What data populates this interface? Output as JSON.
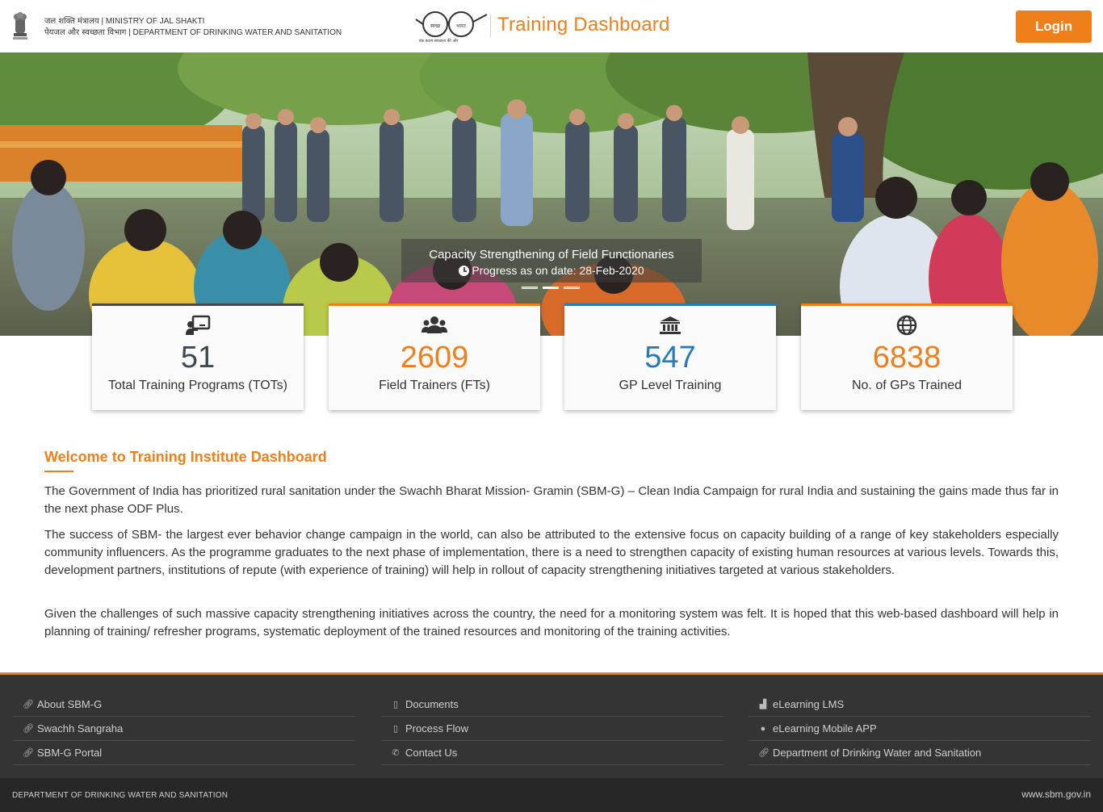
{
  "header": {
    "ministry_line1_hi": "जल शक्ति मंत्रालय",
    "ministry_line1_en": "MINISTRY OF JAL SHAKTI",
    "ministry_line2_hi": "पेयजल और स्वच्छता विभाग",
    "ministry_line2_en": "DEPARTMENT OF DRINKING WATER AND SANITATION",
    "logo_text_left": "स्वच्छ",
    "logo_text_right": "भारत",
    "logo_tagline": "एक कदम स्वच्छता की ओर",
    "title": "Training Dashboard",
    "login_label": "Login"
  },
  "hero": {
    "caption_title": "Capacity Strengthening of Field Functionaries",
    "caption_sub": "Progress as on date: 28-Feb-2020",
    "slide_count": 3,
    "active_slide": 2
  },
  "stats": [
    {
      "icon": "chalkboard-teacher-icon",
      "value": "51",
      "label": "Total Training Programs (TOTs)"
    },
    {
      "icon": "users-icon",
      "value": "2609",
      "label": "Field Trainers (FTs)"
    },
    {
      "icon": "institution-icon",
      "value": "547",
      "label": "GP Level Training"
    },
    {
      "icon": "globe-icon",
      "value": "6838",
      "label": "No. of GPs Trained"
    }
  ],
  "welcome": {
    "heading": "Welcome to Training Institute Dashboard",
    "paragraphs": [
      "The Government of India has prioritized rural sanitation under the Swachh Bharat Mission- Gramin (SBM-G) – Clean India Campaign for rural India and sustaining the gains made thus far in the next phase ODF Plus.",
      "The success of SBM- the largest ever behavior change campaign in the world, can also be attributed to the extensive focus on capacity building of a range of key stakeholders especially community influencers. As the programme graduates to the next phase of implementation, there is a need to strengthen capacity of existing human resources at various levels. Towards this, development partners, institutions of repute (with experience of training) will help in rollout of capacity strengthening initiatives targeted at various stakeholders.",
      "Given the challenges of such massive capacity strengthening initiatives across the country, the need for a monitoring system was felt. It is hoped that this web-based dashboard will help in planning of training/ refresher programs, systematic deployment of the trained resources and monitoring of the training activities."
    ]
  },
  "footer": {
    "col1": [
      {
        "icon": "link-icon",
        "label": "About SBM-G"
      },
      {
        "icon": "link-icon",
        "label": "Swachh Sangraha"
      },
      {
        "icon": "link-icon",
        "label": "SBM-G Portal"
      }
    ],
    "col2": [
      {
        "icon": "document-icon",
        "label": "Documents"
      },
      {
        "icon": "document-icon",
        "label": "Process Flow"
      },
      {
        "icon": "phone-icon",
        "label": "Contact Us"
      }
    ],
    "col3": [
      {
        "icon": "sitemap-icon",
        "label": "eLearning LMS"
      },
      {
        "icon": "android-icon",
        "label": "eLearning Mobile APP"
      },
      {
        "icon": "link-icon",
        "label": "Department of Drinking Water and Sanitation"
      }
    ],
    "bottom_left": "DEPARTMENT OF DRINKING WATER AND SANITATION",
    "bottom_right": "www.sbm.gov.in"
  },
  "colors": {
    "accent": "#ef7f1a",
    "blue": "#2a7ab8",
    "dark_num": "#3d4a52",
    "footer_bg": "#343434",
    "bottom_bar_bg": "#272727"
  }
}
